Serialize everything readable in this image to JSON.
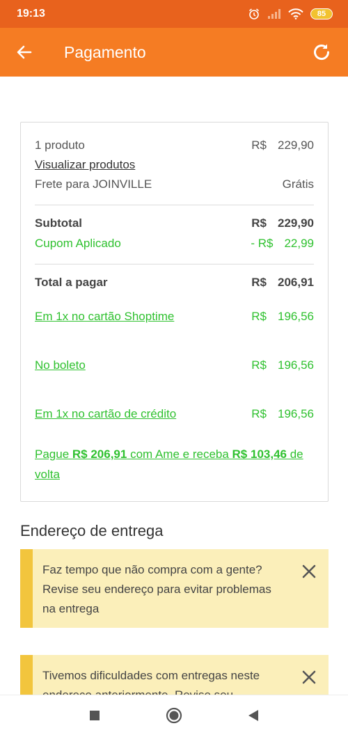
{
  "status_bar": {
    "time": "19:13",
    "battery": "85",
    "icons": [
      "alarm-icon",
      "signal-icon",
      "wifi-icon",
      "battery-icon"
    ]
  },
  "app_bar": {
    "title": "Pagamento",
    "back_icon": "arrow-left-icon",
    "refresh_icon": "refresh-icon",
    "background": "#f57c23"
  },
  "summary": {
    "products_count": "1 produto",
    "products_currency": "R$",
    "products_value": "229,90",
    "view_products_link": "Visualizar produtos",
    "shipping_label": "Frete para JOINVILLE",
    "shipping_value": "Grátis",
    "subtotal_label": "Subtotal",
    "subtotal_currency": "R$",
    "subtotal_value": "229,90",
    "coupon_label": "Cupom Aplicado",
    "coupon_currency": "- R$",
    "coupon_value": "22,99",
    "total_label": "Total a pagar",
    "total_currency": "R$",
    "total_value": "206,91"
  },
  "payment_options": [
    {
      "label": "Em 1x no cartão Shoptime",
      "currency": "R$",
      "value": "196,56"
    },
    {
      "label": "No boleto",
      "currency": "R$",
      "value": "196,56"
    },
    {
      "label": "Em 1x no cartão de crédito",
      "currency": "R$",
      "value": "196,56"
    }
  ],
  "ame_promo": {
    "prefix": "Pague ",
    "amount": "R$ 206,91",
    "middle": " com Ame e receba ",
    "cashback": "R$ 103,46",
    "suffix": " de volta"
  },
  "delivery": {
    "section_title": "Endereço de entrega",
    "alerts": [
      {
        "text": "Faz tempo que não compra com a gente? Revise seu endereço para evitar problemas na entrega"
      },
      {
        "text": "Tivemos dificuldades com entregas neste endereço anteriormente. Revise seu"
      }
    ]
  },
  "colors": {
    "status_bar": "#e8621d",
    "accent": "#f57c23",
    "green": "#2fc12f",
    "alert_bg": "#fbefba",
    "alert_stripe": "#f2c53d"
  },
  "nav_bar": {
    "icons": [
      "recent-apps-icon",
      "home-icon",
      "back-icon"
    ]
  }
}
